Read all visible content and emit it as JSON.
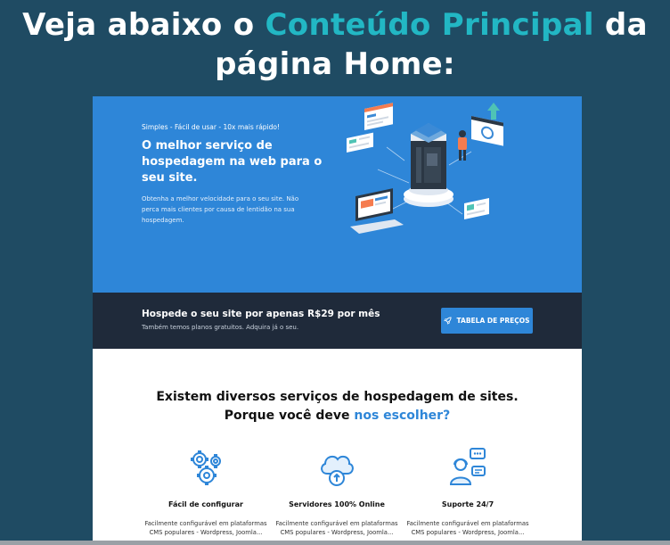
{
  "headline": {
    "line1_prefix": "Veja abaixo o ",
    "line1_accent": "Conteúdo Principal",
    "line1_suffix": " da",
    "line2": "página Home:"
  },
  "hero": {
    "kicker": "Simples - Fácil de usar - 10x mais rápido!",
    "title": "O melhor serviço de hospedagem na web para o seu site.",
    "description": "Obtenha a melhor velocidade para o seu site. Não perca mais clientes por causa de lentidão na sua hospedagem."
  },
  "cta": {
    "title": "Hospede o seu site por apenas R$29 por mês",
    "subtitle": "Também temos planos gratuitos. Adquira já o seu.",
    "button_label": "TABELA DE PREÇOS",
    "button_icon": "rocket-icon"
  },
  "content": {
    "title_line1": "Existem diversos serviços de hospedagem de sites.",
    "title_line2_prefix": "Porque você deve ",
    "title_line2_accent": "nos escolher?"
  },
  "features": [
    {
      "icon": "gears-icon",
      "title": "Fácil de configurar",
      "description": "Facilmente configurável em plataformas CMS populares - Wordpress, Joomla..."
    },
    {
      "icon": "cloud-upload-icon",
      "title": "Servidores 100% Online",
      "description": "Facilmente configurável em plataformas CMS populares - Wordpress, Joomla..."
    },
    {
      "icon": "support-agent-icon",
      "title": "Suporte 24/7",
      "description": "Facilmente configurável em plataformas CMS populares - Wordpress, Joomla..."
    }
  ],
  "colors": {
    "page_background": "#1f4b63",
    "accent_teal": "#22b7c4",
    "hero_blue": "#2e86d8",
    "cta_dark": "#1f2a3a"
  }
}
